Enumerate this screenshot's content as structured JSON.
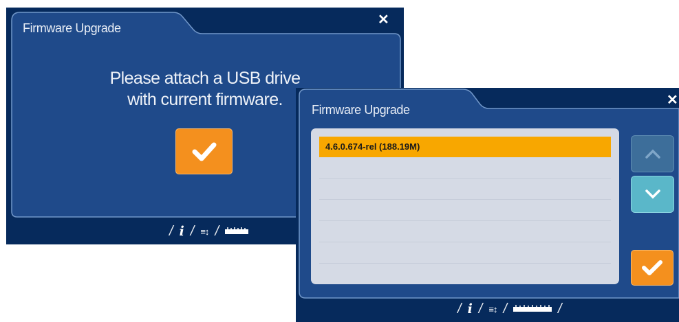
{
  "screen1": {
    "title": "Firmware Upgrade",
    "close_glyph": "✕",
    "message_line1": "Please attach a USB drive",
    "message_line2": "with current firmware.",
    "footer": {
      "slash": "/",
      "info_glyph": "i",
      "list_glyph": "≡↕"
    }
  },
  "screen2": {
    "title": "Firmware Upgrade",
    "close_glyph": "✕",
    "firmware_list": [
      "4.6.0.674-rel (188.19M)"
    ],
    "footer": {
      "slash": "/",
      "info_glyph": "i",
      "list_glyph": "≡↕"
    }
  },
  "colors": {
    "panel": "#1f4a8a",
    "panel_border": "#6f94c6",
    "background": "#062a5c",
    "accent_orange": "#f4901e",
    "selected_row": "#f8a700",
    "list_bg": "#d5dae5",
    "up_button": "#3d6e9a",
    "down_button": "#5ab7c9"
  },
  "icons": [
    "close-icon",
    "checkmark-icon",
    "info-icon",
    "list-sort-icon",
    "ruler-icon",
    "chevron-up-icon",
    "chevron-down-icon"
  ]
}
